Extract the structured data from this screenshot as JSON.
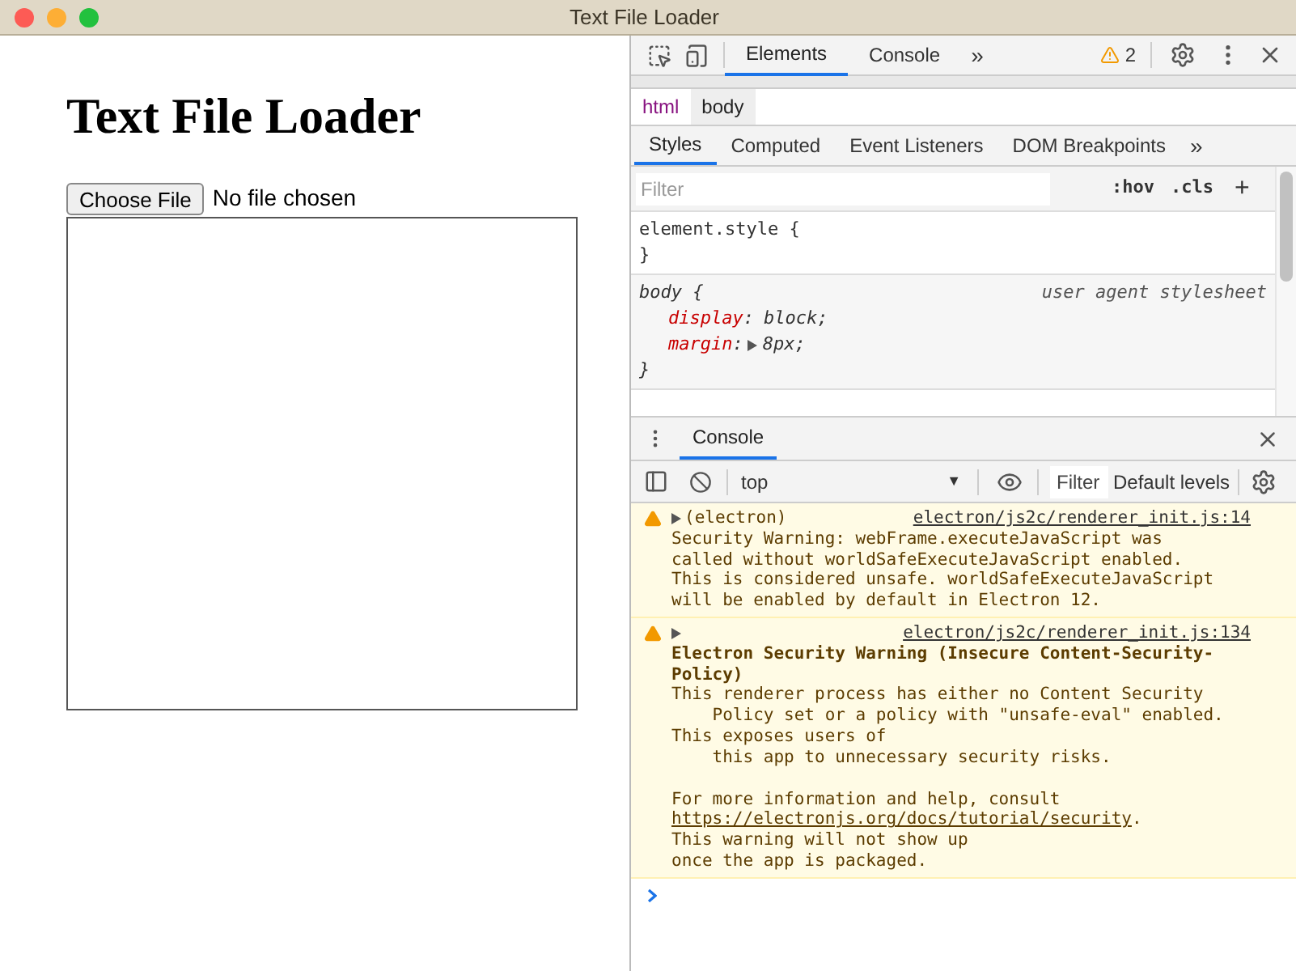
{
  "window": {
    "title": "Text File Loader"
  },
  "page": {
    "heading": "Text File Loader",
    "file_button": "Choose File",
    "file_status": "No file chosen"
  },
  "devtools": {
    "tabs": [
      {
        "label": "Elements",
        "selected": true
      },
      {
        "label": "Console",
        "selected": false
      }
    ],
    "tabs_more": "»",
    "warning_count": "2",
    "breadcrumb": [
      {
        "label": "html",
        "selected": false
      },
      {
        "label": "body",
        "selected": true
      }
    ],
    "style_tabs": [
      {
        "label": "Styles",
        "selected": true
      },
      {
        "label": "Computed",
        "selected": false
      },
      {
        "label": "Event Listeners",
        "selected": false
      },
      {
        "label": "DOM Breakpoints",
        "selected": false
      }
    ],
    "style_tabs_more": "»",
    "filter": {
      "placeholder": "Filter"
    },
    "hov": ":hov",
    "cls": ".cls",
    "plus": "+",
    "rules": [
      {
        "kind": "inline",
        "selector": "element.style {",
        "close": "}"
      },
      {
        "kind": "agent",
        "selector": "body {",
        "source": "user agent stylesheet",
        "props": [
          {
            "name": "display",
            "colon": ":",
            "value": "block;",
            "expandable": false
          },
          {
            "name": "margin",
            "colon": ":",
            "value": "8px;",
            "expandable": true
          }
        ],
        "close": "}"
      }
    ],
    "drawer": {
      "tab": "Console",
      "context": "top",
      "context_caret": "▼",
      "filter": {
        "placeholder": "Filter"
      },
      "levels": "Default levels",
      "messages": [
        {
          "prefix": "(electron)",
          "link": "electron/js2c/renderer_init.js:14",
          "paragraphs": [
            [
              "Security Warning: webFrame.executeJavaScript was",
              "called without worldSafeExecuteJavaScript enabled.",
              "This is considered unsafe. worldSafeExecuteJavaScript",
              "will be enabled by default in Electron 12."
            ]
          ]
        },
        {
          "link": "electron/js2c/renderer_init.js:134",
          "title": "Electron Security Warning (Insecure Content-Security-Policy)",
          "paragraphs": [
            [
              "This renderer process has either no Content Security",
              "    Policy set or a policy with \"unsafe-eval\" enabled.",
              "This exposes users of",
              "    this app to unnecessary security risks."
            ],
            [
              "For more information and help, consult"
            ]
          ],
          "url": "https://electronjs.org/docs/tutorial/security",
          "url_after": ".",
          "tail": [
            "This warning will not show up",
            "once the app is packaged."
          ]
        }
      ]
    }
  }
}
